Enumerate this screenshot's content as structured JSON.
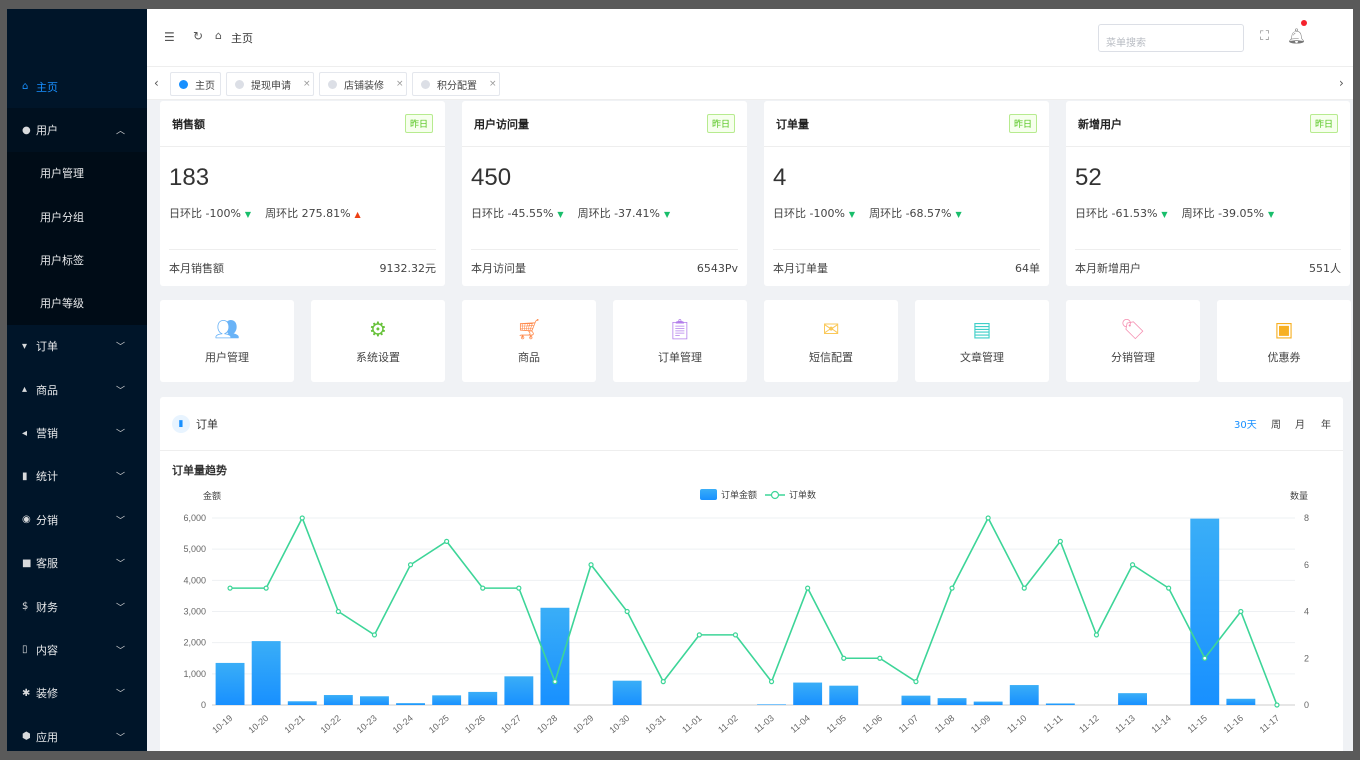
{
  "sidebar": {
    "items": [
      {
        "label": "主页",
        "icon": "home-icon"
      },
      {
        "label": "用户",
        "icon": "user-icon"
      },
      {
        "label": "用户管理"
      },
      {
        "label": "用户分组"
      },
      {
        "label": "用户标签"
      },
      {
        "label": "用户等级"
      },
      {
        "label": "订单",
        "icon": "cart-icon"
      },
      {
        "label": "商品",
        "icon": "goods-icon"
      },
      {
        "label": "营销",
        "icon": "send-icon"
      },
      {
        "label": "统计",
        "icon": "stats-icon"
      },
      {
        "label": "分销",
        "icon": "distribution-icon"
      },
      {
        "label": "客服",
        "icon": "chat-icon"
      },
      {
        "label": "财务",
        "icon": "dollar-icon"
      },
      {
        "label": "内容",
        "icon": "book-icon"
      },
      {
        "label": "装修",
        "icon": "tools-icon"
      },
      {
        "label": "应用",
        "icon": "app-icon"
      }
    ]
  },
  "header": {
    "breadcrumb": "主页",
    "search_placeholder": "菜单搜索"
  },
  "tabs": [
    {
      "label": "主页"
    },
    {
      "label": "提现申请",
      "close": "×"
    },
    {
      "label": "店铺装修",
      "close": "×"
    },
    {
      "label": "积分配置",
      "close": "×"
    }
  ],
  "stats": [
    {
      "title": "销售额",
      "badge": "昨日",
      "value": "183",
      "day": "日环比 -100%",
      "week": "周环比 275.81%",
      "week_trend": "up",
      "foot_label": "本月销售额",
      "foot_value": "9132.32元"
    },
    {
      "title": "用户访问量",
      "badge": "昨日",
      "value": "450",
      "day": "日环比 -45.55%",
      "week": "周环比 -37.41%",
      "week_trend": "down",
      "foot_label": "本月访问量",
      "foot_value": "6543Pv"
    },
    {
      "title": "订单量",
      "badge": "昨日",
      "value": "4",
      "day": "日环比 -100%",
      "week": "周环比 -68.57%",
      "week_trend": "down",
      "foot_label": "本月订单量",
      "foot_value": "64单"
    },
    {
      "title": "新增用户",
      "badge": "昨日",
      "value": "52",
      "day": "日环比 -61.53%",
      "week": "周环比 -39.05%",
      "week_trend": "down",
      "foot_label": "本月新增用户",
      "foot_value": "551人"
    }
  ],
  "quick": [
    {
      "label": "用户管理",
      "icon": "users-icon",
      "color": "#69b3f7"
    },
    {
      "label": "系统设置",
      "icon": "gear-icon",
      "color": "#67c23a"
    },
    {
      "label": "商品",
      "icon": "cart-icon",
      "color": "#ff8a4c"
    },
    {
      "label": "订单管理",
      "icon": "clipboard-icon",
      "color": "#b37feb"
    },
    {
      "label": "短信配置",
      "icon": "mail-icon",
      "color": "#fac858"
    },
    {
      "label": "文章管理",
      "icon": "card-icon",
      "color": "#3fcfc8"
    },
    {
      "label": "分销管理",
      "icon": "tag-icon",
      "color": "#f58fb1"
    },
    {
      "label": "优惠券",
      "icon": "coupon-icon",
      "color": "#f7b023"
    }
  ],
  "chart_panel": {
    "title": "订单",
    "ranges": [
      "30天",
      "周",
      "月",
      "年"
    ],
    "active_range": "30天"
  },
  "chart_data": {
    "type": "bar",
    "title": "订单量趋势",
    "ylabel": "金额",
    "y2label": "数量",
    "ylim": [
      0,
      6000
    ],
    "y2lim": [
      0,
      8
    ],
    "yticks": [
      "0",
      "1,000",
      "2,000",
      "3,000",
      "4,000",
      "5,000",
      "6,000"
    ],
    "y2ticks": [
      "0",
      "2",
      "4",
      "6",
      "8"
    ],
    "legend_position": "top-center",
    "categories": [
      "10-19",
      "10-20",
      "10-21",
      "10-22",
      "10-23",
      "10-24",
      "10-25",
      "10-26",
      "10-27",
      "10-28",
      "10-29",
      "10-30",
      "10-31",
      "11-01",
      "11-02",
      "11-03",
      "11-04",
      "11-05",
      "11-06",
      "11-07",
      "11-08",
      "11-09",
      "11-10",
      "11-11",
      "11-12",
      "11-13",
      "11-14",
      "11-15",
      "11-16",
      "11-17"
    ],
    "series": [
      {
        "name": "订单金额",
        "type": "bar",
        "axis": "left",
        "color": "#1890ff",
        "values": [
          1350,
          2050,
          120,
          320,
          280,
          60,
          310,
          420,
          920,
          3120,
          0,
          780,
          0,
          0,
          0,
          20,
          720,
          620,
          0,
          300,
          220,
          110,
          640,
          50,
          0,
          380,
          0,
          5980,
          200,
          0
        ]
      },
      {
        "name": "订单数",
        "type": "line",
        "axis": "right",
        "color": "#3dd598",
        "values": [
          5,
          5,
          8,
          4,
          3,
          6,
          7,
          5,
          5,
          1,
          6,
          4,
          1,
          3,
          3,
          1,
          5,
          2,
          2,
          1,
          5,
          8,
          5,
          7,
          3,
          6,
          5,
          2,
          4,
          0
        ]
      }
    ]
  }
}
